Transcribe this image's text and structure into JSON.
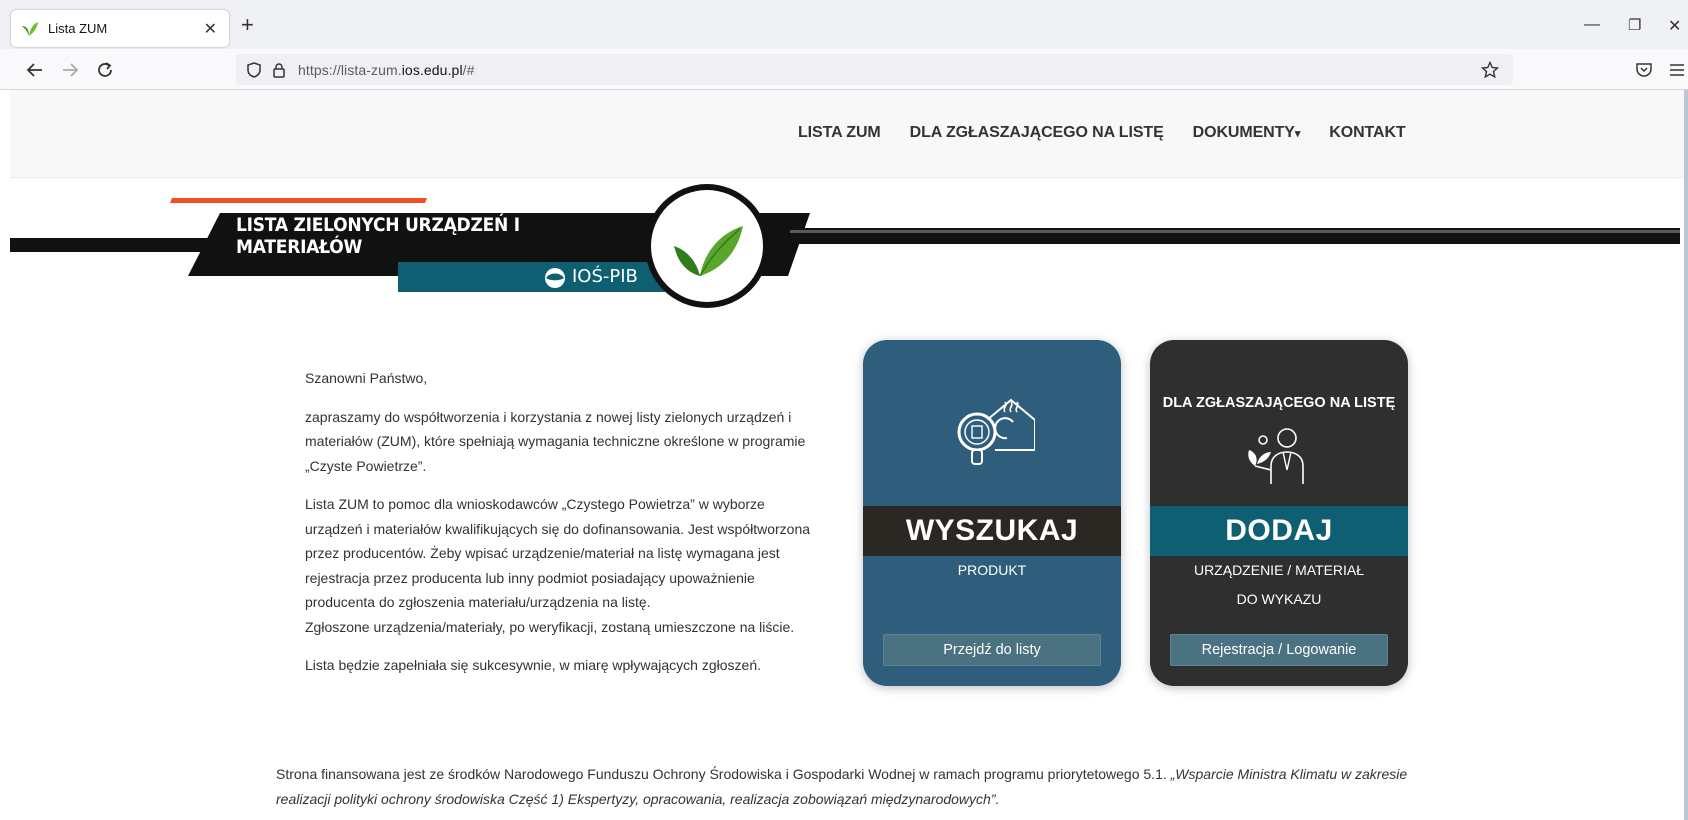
{
  "browser": {
    "tab_title": "Lista ZUM",
    "url_prefix": "https://lista-zum.",
    "url_domain": "ios.edu.pl",
    "url_suffix": "/#"
  },
  "site_nav": {
    "items": [
      "LISTA ZUM",
      "DLA ZGŁASZAJĄCEGO NA LISTĘ",
      "DOKUMENTY",
      "KONTAKT"
    ],
    "dropdown_marker": "▾"
  },
  "banner": {
    "title": "LISTA ZIELONYCH URZĄDZEŃ I MATERIAŁÓW",
    "org": "IOŚ-PIB",
    "colors": {
      "accent_orange": "#f04e23",
      "teal": "#0f5f73",
      "black": "#111111",
      "leaf_green": "#5aa52b"
    }
  },
  "intro": {
    "greeting": "Szanowni Państwo,",
    "p1": "zapraszamy do współtworzenia i korzystania z nowej listy zielonych urządzeń i materiałów (ZUM), które spełniają wymagania techniczne określone w programie „Czyste Powietrze”.",
    "p2": "Lista ZUM to pomoc dla wnioskodawców „Czystego Powietrza” w wyborze urządzeń i materiałów kwalifikujących się do dofinansowania. Jest współtworzona przez producentów. Żeby wpisać urządzenie/materiał na listę wymagana jest rejestracja przez producenta lub inny podmiot posiadający upoważnienie producenta do zgłoszenia materiału/urządzenia na listę.",
    "p2b": "Zgłoszone urządzenia/materiały, po weryfikacji, zostaną umieszczone na liście.",
    "p3": "Lista będzie zapełniała się sukcesywnie, w miarę wpływających zgłoszeń."
  },
  "card_search": {
    "icon": "magnifier-house-icon",
    "title": "WYSZUKAJ",
    "subtitle": "PRODUKT",
    "button": "Przejdź do listy",
    "colors": {
      "bg": "#2f5d7c",
      "band": "#2b2723"
    }
  },
  "card_add": {
    "icon": "person-leaf-icon",
    "heading": "DLA ZGŁASZAJĄCEGO NA LISTĘ",
    "title": "DODAJ",
    "subtitle_line1": "URZĄDZENIE / MATERIAŁ",
    "subtitle_line2": "DO WYKAZU",
    "button": "Rejestracja / Logowanie",
    "colors": {
      "bg": "#2f2f2f",
      "band": "#0f5f73"
    }
  },
  "footer": {
    "text": "Strona finansowana jest ze środków Narodowego Funduszu Ochrony Środowiska i Gospodarki Wodnej w ramach programu priorytetowego 5.1. ",
    "italic": "„Wsparcie Ministra Klimatu w zakresie realizacji polityki ochrony środowiska Część 1) Ekspertyzy, opracowania, realizacja zobowiązań międzynarodowych”."
  }
}
